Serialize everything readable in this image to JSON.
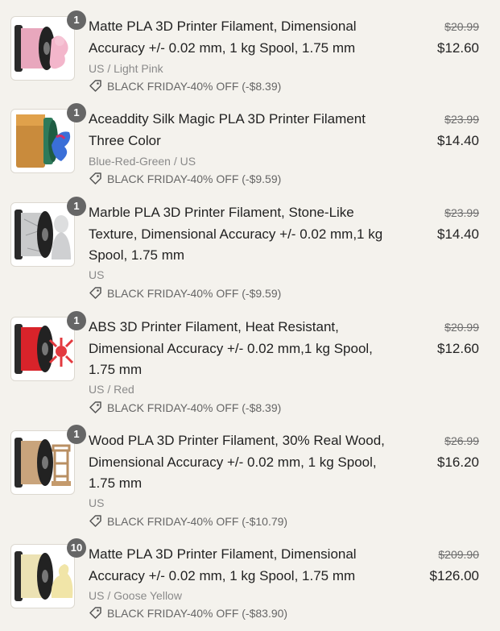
{
  "items": [
    {
      "quantity": "1",
      "title": "Matte PLA 3D Printer Filament, Dimensional Accuracy +/- 0.02 mm, 1 kg Spool, 1.75 mm",
      "variant": "US / Light Pink",
      "discount": "BLACK FRIDAY-40% OFF (-$8.39)",
      "original_price": "$20.99",
      "price": "$12.60",
      "filament_color": "#e8a7bd",
      "image": "pink-filament-spool"
    },
    {
      "quantity": "1",
      "title": "Aceaddity Silk Magic PLA 3D Printer Filament Three Color",
      "variant": "Blue-Red-Green / US",
      "discount": "BLACK FRIDAY-40% OFF (-$9.59)",
      "original_price": "$23.99",
      "price": "$14.40",
      "filament_color": "#2e7a5a",
      "image": "tricolor-filament-spool"
    },
    {
      "quantity": "1",
      "title": "Marble PLA 3D Printer Filament, Stone-Like Texture, Dimensional Accuracy +/- 0.02 mm,1 kg Spool, 1.75 mm",
      "variant": "US",
      "discount": "BLACK FRIDAY-40% OFF (-$9.59)",
      "original_price": "$23.99",
      "price": "$14.40",
      "filament_color": "#c9cacb",
      "image": "marble-filament-spool"
    },
    {
      "quantity": "1",
      "title": "ABS 3D Printer Filament, Heat Resistant, Dimensional Accuracy +/- 0.02 mm,1 kg Spool, 1.75 mm",
      "variant": "US / Red",
      "discount": "BLACK FRIDAY-40% OFF (-$8.39)",
      "original_price": "$20.99",
      "price": "$12.60",
      "filament_color": "#d8232a",
      "image": "red-abs-filament-spool"
    },
    {
      "quantity": "1",
      "title": "Wood PLA 3D Printer Filament, 30% Real Wood, Dimensional Accuracy +/- 0.02 mm, 1 kg Spool, 1.75 mm",
      "variant": "US",
      "discount": "BLACK FRIDAY-40% OFF (-$10.79)",
      "original_price": "$26.99",
      "price": "$16.20",
      "filament_color": "#c9a47c",
      "image": "wood-filament-spool"
    },
    {
      "quantity": "10",
      "title": "Matte PLA 3D Printer Filament, Dimensional Accuracy +/- 0.02 mm, 1 kg Spool, 1.75 mm",
      "variant": "US / Goose Yellow",
      "discount": "BLACK FRIDAY-40% OFF (-$83.90)",
      "original_price": "$209.90",
      "price": "$126.00",
      "filament_color": "#ece2b4",
      "image": "yellow-filament-spool"
    }
  ]
}
